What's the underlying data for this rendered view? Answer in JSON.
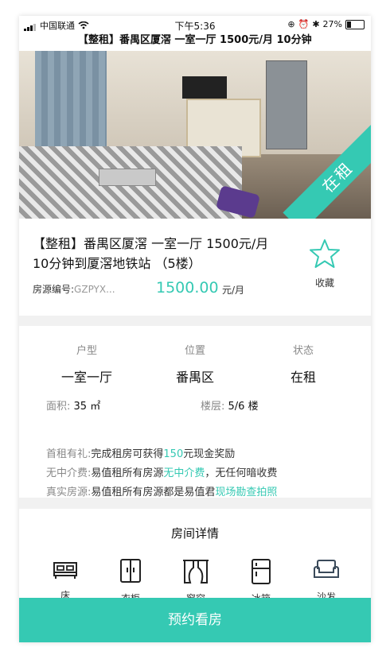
{
  "status_bar": {
    "carrier": "中国联通",
    "time": "下午5:36",
    "battery": "27%"
  },
  "title_bar": {
    "text": "【整租】番禺区厦滘 一室一厅 1500元/月 10分钟"
  },
  "hero": {
    "ribbon": "在租"
  },
  "listing": {
    "title": "【整租】番禺区厦滘 一室一厅 1500元/月 10分钟到厦滘地铁站 （5楼）",
    "code_label": "房源编号:",
    "code_value": "GZPYX...",
    "price": "1500.00",
    "price_unit": "元/月",
    "favorite_label": "收藏"
  },
  "details": {
    "layout_label": "户型",
    "layout_value": "一室一厅",
    "location_label": "位置",
    "location_value": "番禺区",
    "status_label": "状态",
    "status_value": "在租",
    "area_label": "面积:",
    "area_value": "35 ㎡",
    "floor_label": "楼层:",
    "floor_value": "5/6 楼",
    "perks": [
      {
        "label": "首租有礼:",
        "text_before": "完成租房可获得",
        "highlight": "150",
        "text_after": "元现金奖励"
      },
      {
        "label": "无中介费:",
        "text_before": "易值租所有房源",
        "highlight": "无中介费",
        "text_after": "，无任何暗收费"
      },
      {
        "label": "真实房源:",
        "text_before": "易值租所有房源都是易值君",
        "highlight": "现场勘查拍照",
        "text_after": ""
      }
    ]
  },
  "room": {
    "heading": "房间详情",
    "amenities": [
      {
        "icon": "bed-icon",
        "label": "床"
      },
      {
        "icon": "wardrobe-icon",
        "label": "衣柜"
      },
      {
        "icon": "curtain-icon",
        "label": "窗帘"
      },
      {
        "icon": "fridge-icon",
        "label": "冰箱"
      },
      {
        "icon": "sofa-icon",
        "label": "沙发"
      }
    ]
  },
  "cta": {
    "label": "预约看房"
  },
  "colors": {
    "accent": "#35c9b3"
  }
}
